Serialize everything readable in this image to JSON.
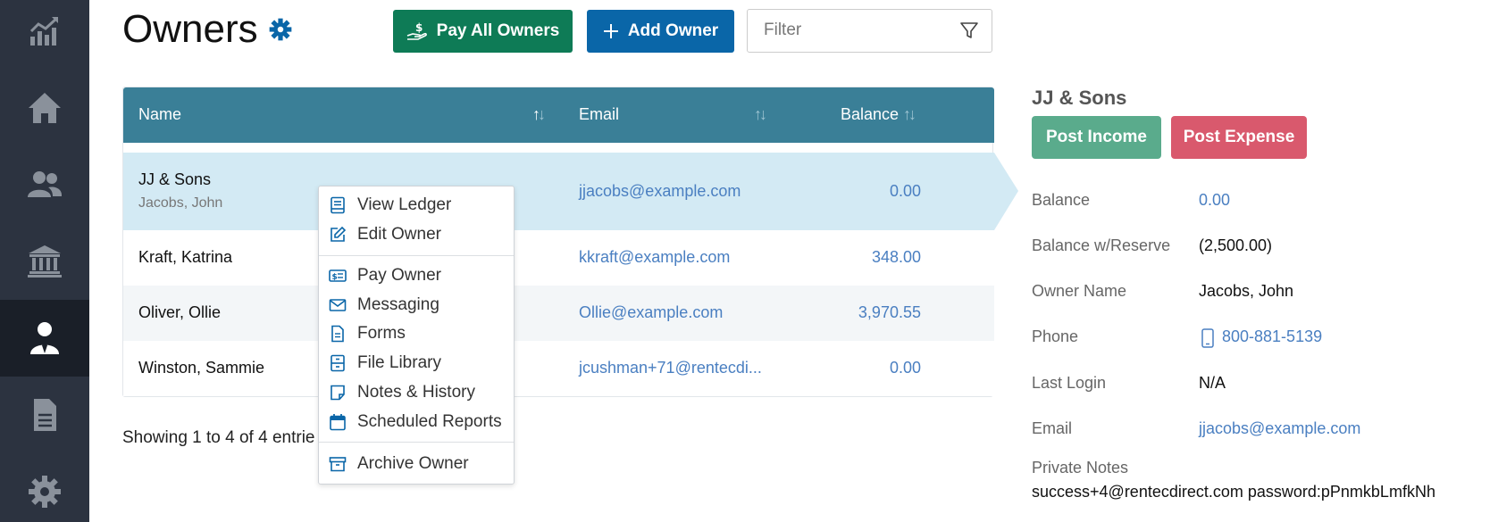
{
  "sidebar": {
    "items": [
      {
        "icon": "chart-icon"
      },
      {
        "icon": "home-icon"
      },
      {
        "icon": "users-icon"
      },
      {
        "icon": "bank-icon"
      },
      {
        "icon": "owner-icon",
        "active": true
      },
      {
        "icon": "document-icon"
      },
      {
        "icon": "gear-icon"
      }
    ],
    "background": "#2c3340",
    "active_background": "#1a1f28"
  },
  "header": {
    "title": "Owners",
    "pay_all_label": "Pay All Owners",
    "add_owner_label": "Add Owner",
    "filter_placeholder": "Filter"
  },
  "table": {
    "columns": {
      "name": "Name",
      "email": "Email",
      "balance": "Balance"
    },
    "header_color": "#3a7f97",
    "rows": [
      {
        "name": "JJ & Sons",
        "subname": "Jacobs, John",
        "email": "jjacobs@example.com",
        "balance": "0.00",
        "selected": true
      },
      {
        "name": "Kraft, Katrina",
        "email": "kkraft@example.com",
        "balance": "348.00"
      },
      {
        "name": "Oliver, Ollie",
        "email": "Ollie@example.com",
        "balance": "3,970.55"
      },
      {
        "name": "Winston, Sammie",
        "email": "jcushman+71@rentecdi...",
        "balance": "0.00"
      }
    ],
    "footer": "Showing 1 to 4 of 4 entrie"
  },
  "context_menu": {
    "items": [
      {
        "label": "View Ledger",
        "icon": "ledger-icon"
      },
      {
        "label": "Edit Owner",
        "icon": "edit-icon"
      },
      {
        "label": "Pay Owner",
        "icon": "payment-icon"
      },
      {
        "label": "Messaging",
        "icon": "envelope-icon"
      },
      {
        "label": "Forms",
        "icon": "form-icon"
      },
      {
        "label": "File Library",
        "icon": "file-library-icon"
      },
      {
        "label": "Notes & History",
        "icon": "note-icon"
      },
      {
        "label": "Scheduled Reports",
        "icon": "calendar-icon"
      },
      {
        "label": "Archive Owner",
        "icon": "archive-icon"
      }
    ]
  },
  "detail": {
    "title": "JJ & Sons",
    "post_income_label": "Post Income",
    "post_expense_label": "Post Expense",
    "fields": {
      "balance": {
        "label": "Balance",
        "value": "0.00"
      },
      "balance_reserve": {
        "label": "Balance w/Reserve",
        "value": "(2,500.00)"
      },
      "owner_name": {
        "label": "Owner Name",
        "value": "Jacobs, John"
      },
      "phone": {
        "label": "Phone",
        "value": "800-881-5139"
      },
      "last_login": {
        "label": "Last Login",
        "value": "N/A"
      },
      "email": {
        "label": "Email",
        "value": "jjacobs@example.com"
      }
    },
    "notes_label": "Private Notes",
    "notes_value": "success+4@rentecdirect.com password:pPnmkbLmfkNh"
  },
  "colors": {
    "pay_all": "#0e7b56",
    "add_owner": "#0a66a8",
    "post_income": "#5aab8c",
    "post_expense": "#d9596d",
    "link": "#4a7fc1",
    "selected_row": "#d3eaf4"
  }
}
